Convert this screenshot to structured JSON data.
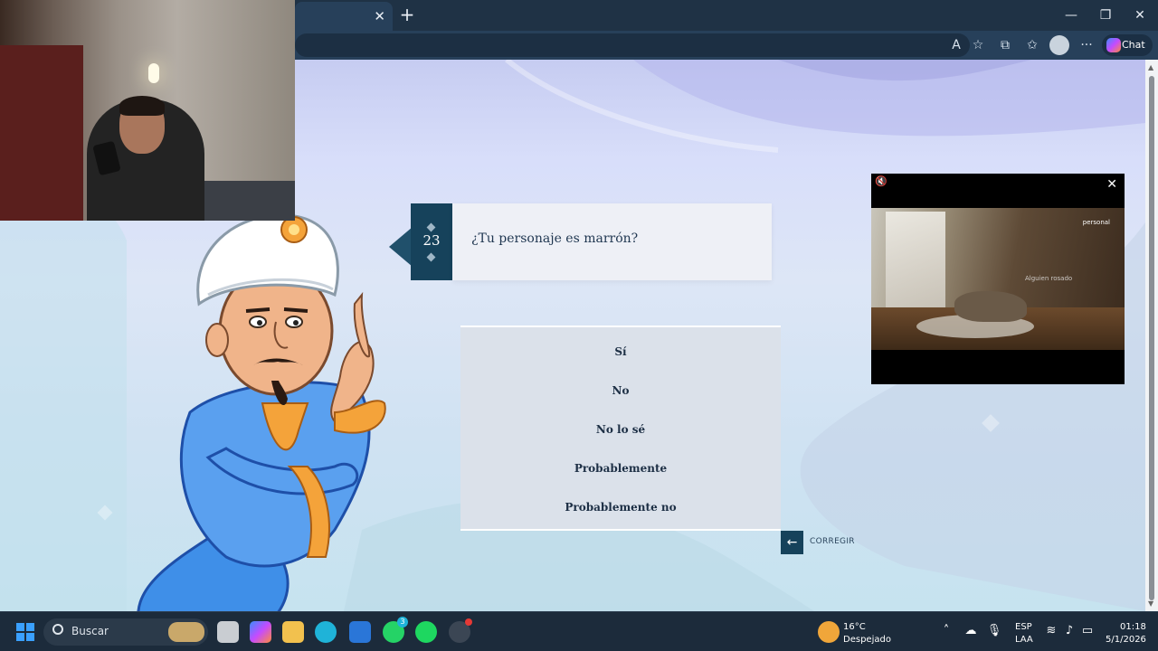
{
  "browser": {
    "tab_close": "✕",
    "new_tab": "+",
    "window_controls": {
      "minimize": "—",
      "maximize": "❐",
      "close": "✕"
    },
    "toolbar_icons": [
      "read-aloud-icon",
      "favorite-star-icon",
      "extensions-icon",
      "favorites-icon",
      "profile-icon",
      "more-icon"
    ],
    "more_label": "···",
    "chat_label": "Chat"
  },
  "game": {
    "question_number": "23",
    "question_text": "¿Tu personaje es marrón?",
    "answers": [
      "Sí",
      "No",
      "No lo sé",
      "Probablemente",
      "Probablemente no"
    ],
    "back_label": "CORREGIR",
    "back_icon": "←"
  },
  "ad": {
    "mute_icon": "🔇",
    "close_icon": "✕",
    "overlay_text": "personal",
    "caption_text": "Alguien rosado"
  },
  "taskbar": {
    "search_label": "Buscar",
    "weather_temp": "16°C",
    "weather_desc": "Despejado",
    "language_line1": "ESP",
    "language_line2": "LAA",
    "time": "01:18",
    "date": "5/1/2026",
    "whatsapp_badge": "3",
    "colors": {
      "start": "#3aa0ff",
      "edge": "#1fb3d8",
      "whatsapp": "#25d366",
      "spotify": "#1ed760"
    }
  },
  "colors": {
    "accent_dark_teal": "#16425b",
    "answer_panel": "#dbe1ea",
    "question_card": "#eef0f6"
  }
}
